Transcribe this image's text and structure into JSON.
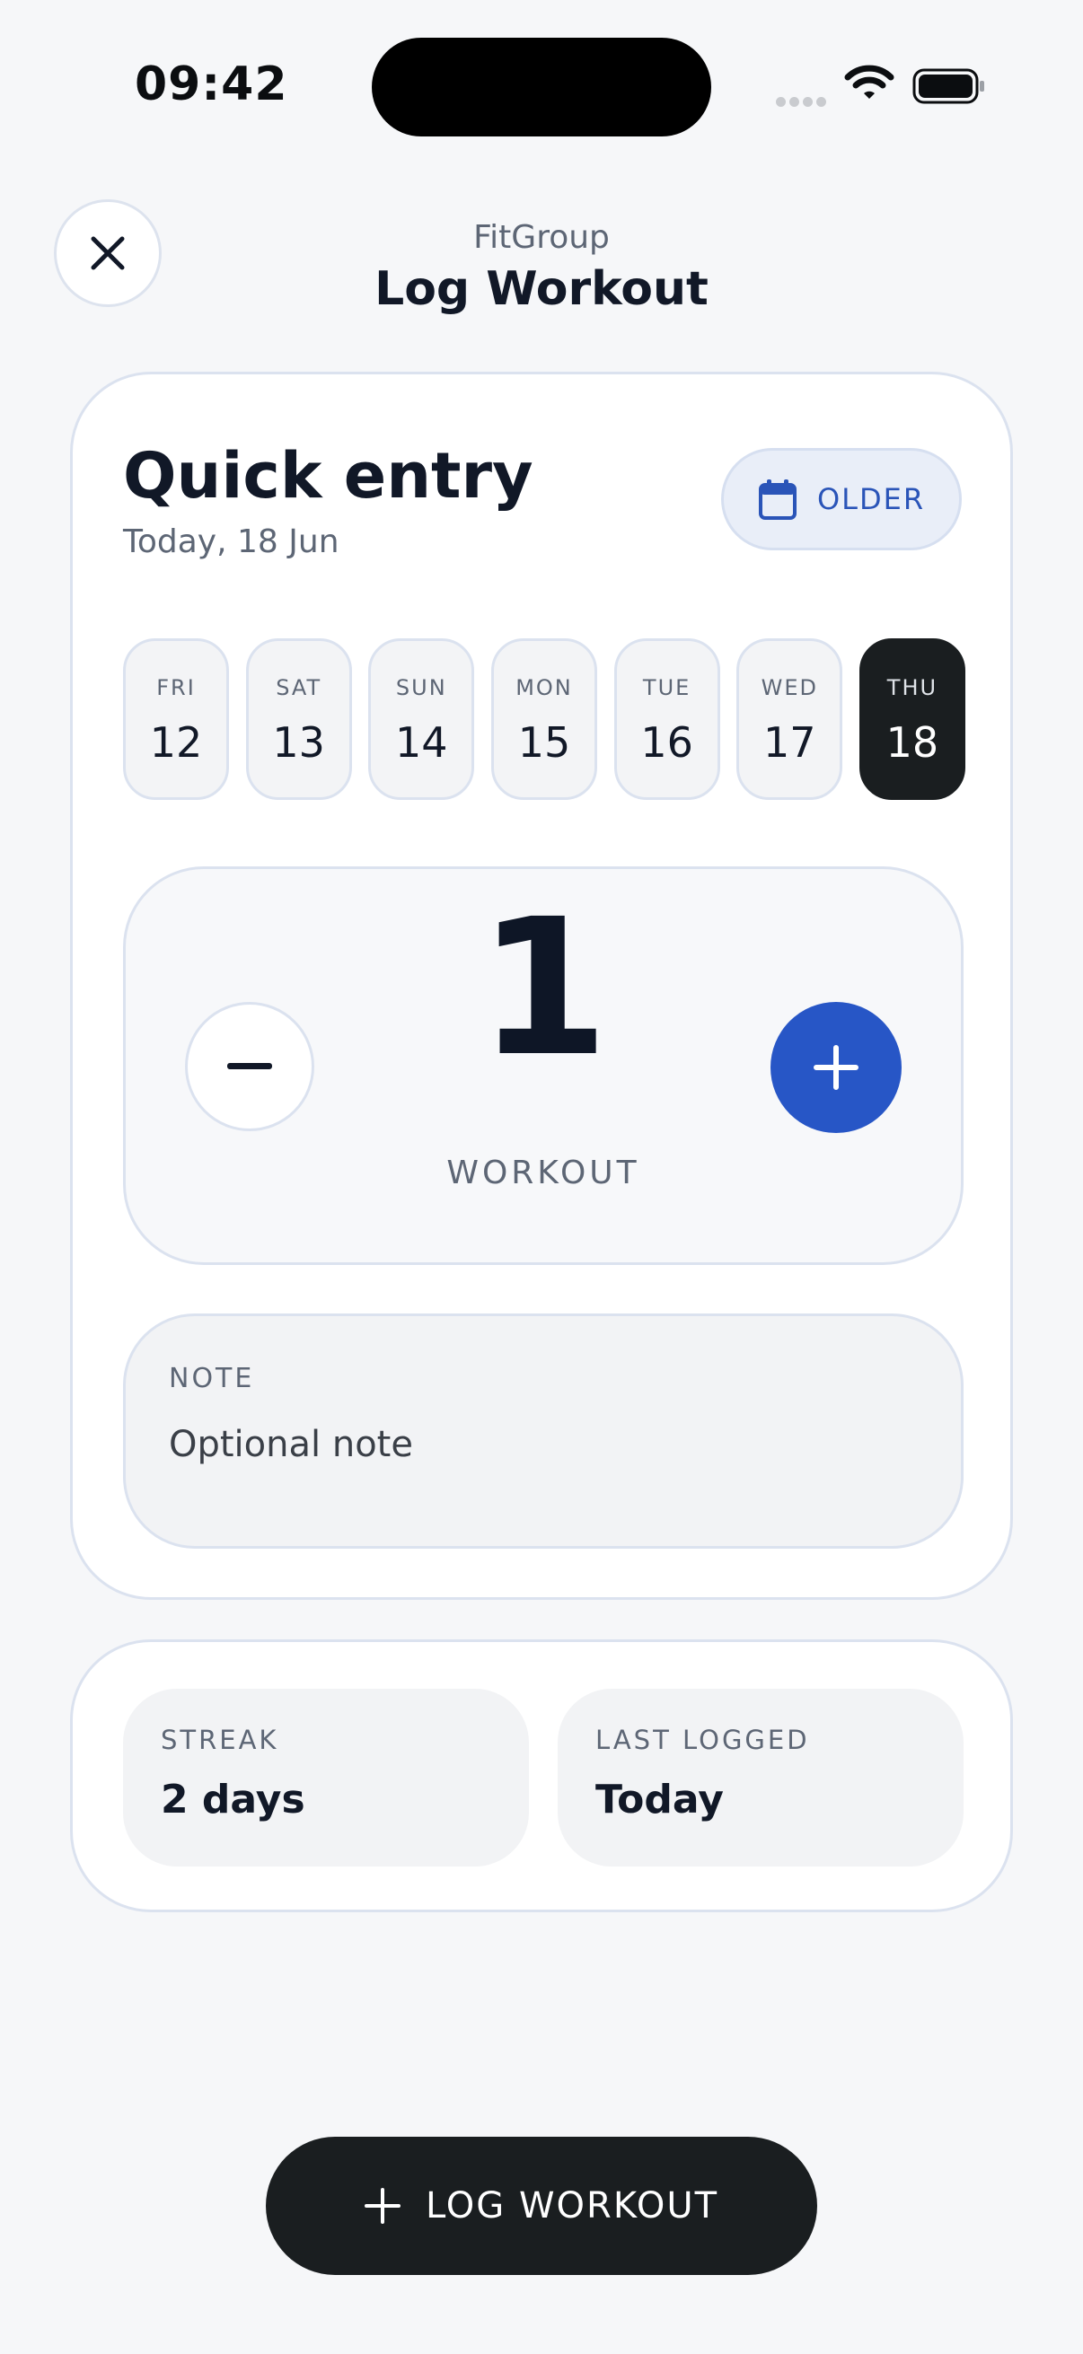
{
  "status_bar": {
    "time": "09:42"
  },
  "header": {
    "app_name": "FitGroup",
    "title": "Log Workout",
    "close_icon": "close-icon"
  },
  "quick_entry": {
    "title": "Quick entry",
    "subtitle": "Today, 18 Jun",
    "older_label": "OLDER",
    "older_icon": "calendar-icon",
    "days": [
      {
        "dow": "FRI",
        "num": "12"
      },
      {
        "dow": "SAT",
        "num": "13"
      },
      {
        "dow": "SUN",
        "num": "14"
      },
      {
        "dow": "MON",
        "num": "15"
      },
      {
        "dow": "TUE",
        "num": "16"
      },
      {
        "dow": "WED",
        "num": "17"
      },
      {
        "dow": "THU",
        "num": "18"
      }
    ],
    "selected_day": "THU",
    "counter": {
      "value": "1",
      "unit": "WORKOUT"
    },
    "note": {
      "label": "NOTE",
      "placeholder": "Optional note",
      "value": ""
    }
  },
  "stats": {
    "streak_label": "STREAK",
    "streak_value": "2 days",
    "last_logged_label": "LAST LOGGED",
    "last_logged_value": "Today"
  },
  "footer": {
    "log_label": "LOG WORKOUT"
  },
  "colors": {
    "accent": "#2756c6",
    "dark": "#1a1e20",
    "background": "#f6f7f9"
  }
}
